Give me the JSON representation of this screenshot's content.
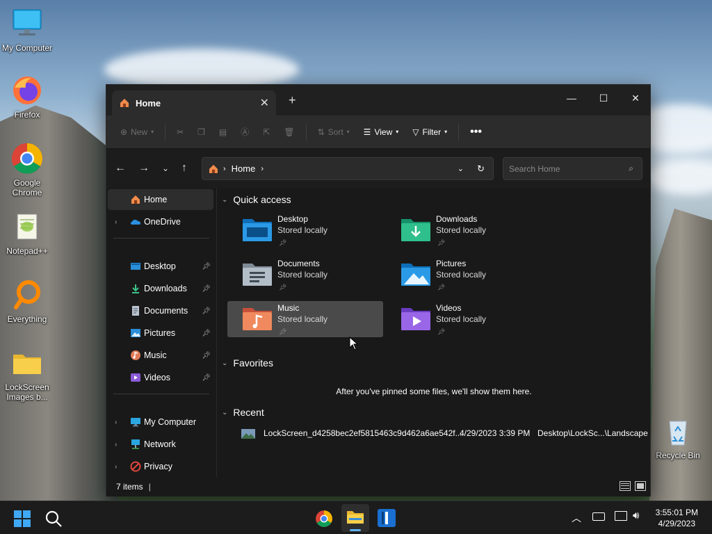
{
  "desktop": {
    "icons": [
      {
        "label": "My Computer"
      },
      {
        "label": "Firefox"
      },
      {
        "label": "Google Chrome"
      },
      {
        "label": "Notepad++"
      },
      {
        "label": "Everything"
      },
      {
        "label": "LockScreen Images b..."
      },
      {
        "label": "Recycle Bin"
      }
    ]
  },
  "window": {
    "tab_title": "Home",
    "toolbar": {
      "new_label": "New",
      "sort_label": "Sort",
      "view_label": "View",
      "filter_label": "Filter"
    },
    "address": {
      "crumb": "Home"
    },
    "search": {
      "placeholder": "Search Home"
    },
    "sidebar": {
      "home": "Home",
      "onedrive": "OneDrive",
      "pinned": [
        "Desktop",
        "Downloads",
        "Documents",
        "Pictures",
        "Music",
        "Videos"
      ],
      "bottom": [
        "My Computer",
        "Network",
        "Privacy"
      ]
    },
    "quick_access": {
      "heading": "Quick access",
      "items": [
        {
          "name": "Desktop",
          "status": "Stored locally"
        },
        {
          "name": "Downloads",
          "status": "Stored locally"
        },
        {
          "name": "Documents",
          "status": "Stored locally"
        },
        {
          "name": "Pictures",
          "status": "Stored locally"
        },
        {
          "name": "Music",
          "status": "Stored locally"
        },
        {
          "name": "Videos",
          "status": "Stored locally"
        }
      ]
    },
    "favorites": {
      "heading": "Favorites",
      "empty_message": "After you've pinned some files, we'll show them here."
    },
    "recent": {
      "heading": "Recent",
      "items": [
        {
          "name": "LockScreen_d4258bec2ef5815463c9d462a6ae542f...",
          "date": "4/29/2023 3:39 PM",
          "location": "Desktop\\LockSc...\\Landscape"
        }
      ]
    },
    "status": {
      "item_count": "7 items"
    }
  },
  "taskbar": {
    "time": "3:55:01 PM",
    "date": "4/29/2023"
  }
}
